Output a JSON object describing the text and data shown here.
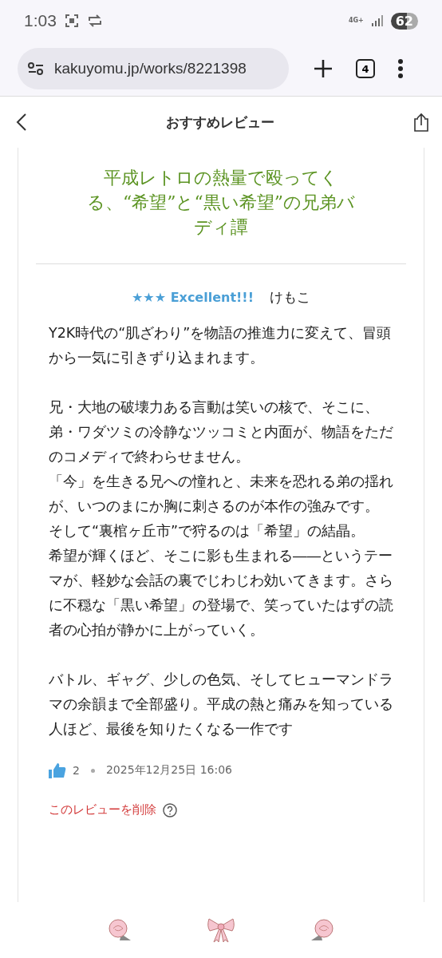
{
  "status_bar": {
    "time": "1:03",
    "network": "4G+",
    "battery": "62"
  },
  "browser": {
    "url": "kakuyomu.jp/works/8221398",
    "tab_count": "4"
  },
  "header": {
    "title": "おすすめレビュー"
  },
  "review": {
    "title": "平成レトロの熱量で殴ってくる、“希望”と“黒い希望”の兄弟バディ譚",
    "rating_stars": "★★★",
    "rating_label": "Excellent!!!",
    "author": "けもこ",
    "body": [
      [
        "Y2K時代の“肌ざわり”を物語の推進力に変えて、冒頭から一気に引きずり込まれます。"
      ],
      [
        "兄・大地の破壊力ある言動は笑いの核で、そこに、弟・ワダツミの冷静なツッコミと内面が、物語をただのコメディで終わらせません。",
        "「今」を生きる兄への憧れと、未来を恐れる弟の揺れが、いつのまにか胸に刺さるのが本作の強みです。",
        "そして“裏棺ヶ丘市”で狩るのは「希望」の結晶。",
        "希望が輝くほど、そこに影も生まれる――というテーマが、軽妙な会話の裏でじわじわ効いてきます。さらに不穏な「黒い希望」の登場で、笑っていたはずの読者の心拍が静かに上がっていく。"
      ],
      [
        "バトル、ギャグ、少しの色気、そしてヒューマンドラマの余韻まで全部盛り。平成の熱と痛みを知っている人ほど、最後を知りたくなる一作です"
      ]
    ],
    "likes": "2",
    "date": "2025年12月25日 16:06",
    "delete_link": "このレビューを削除"
  }
}
